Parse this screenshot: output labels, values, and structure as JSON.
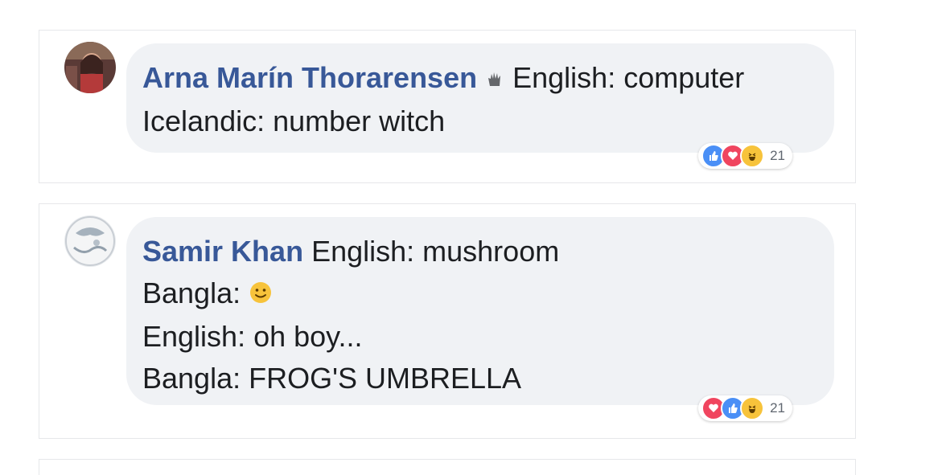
{
  "comments": [
    {
      "author": "Arna Marín Thorarensen",
      "author_badge_icon": "top-fan-hand-icon",
      "lines": [
        "English: computer",
        "Icelandic: number witch"
      ],
      "reactions": [
        "like",
        "love",
        "haha"
      ],
      "reaction_count": "21"
    },
    {
      "author": "Samir Khan",
      "lines": [
        "English: mushroom",
        "Bangla:",
        "English: oh boy...",
        "Bangla: FROG'S UMBRELLA"
      ],
      "inline_emoji_icon": "slight-smile-emoji-icon",
      "reactions": [
        "love",
        "like",
        "haha"
      ],
      "reaction_count": "21"
    }
  ],
  "colors": {
    "author_name": "#385898",
    "bubble_bg": "#f0f2f5",
    "like": "#4a8ff6",
    "love": "#f0455f",
    "haha": "#f7c33b"
  }
}
